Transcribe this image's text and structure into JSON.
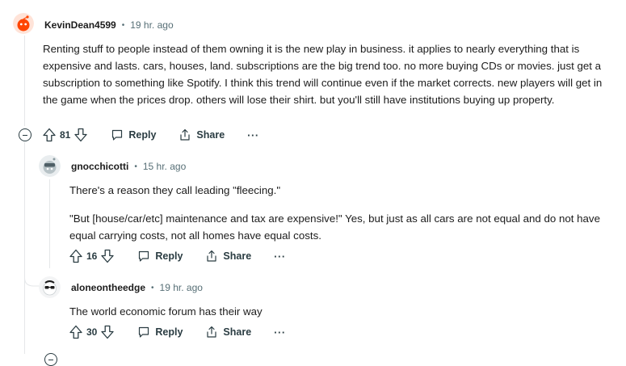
{
  "comments": [
    {
      "username": "KevinDean4599",
      "separator": "•",
      "time": "19 hr. ago",
      "body": "Renting stuff to people instead of them owning it is the new play in business. it applies to nearly everything that is expensive and lasts. cars, houses, land. subscriptions are the big trend too. no more buying CDs or movies. just get a subscription to something like Spotify. I think this trend will continue even if the market corrects. new players will get in the game when the prices drop. others will lose their shirt. but you'll still have institutions buying up property.",
      "votes": "81",
      "reply_label": "Reply",
      "share_label": "Share",
      "more": "···"
    },
    {
      "username": "gnocchicotti",
      "separator": "•",
      "time": "15 hr. ago",
      "body1": "There's a reason they call leading \"fleecing.\"",
      "body2": "\"But [house/car/etc] maintenance and tax are expensive!\" Yes, but just as all cars are not equal and do not have equal carrying costs, not all homes have equal costs.",
      "votes": "16",
      "reply_label": "Reply",
      "share_label": "Share",
      "more": "···"
    },
    {
      "username": "aloneontheedge",
      "separator": "•",
      "time": "19 hr. ago",
      "body": "The world economic forum has their way",
      "votes": "30",
      "reply_label": "Reply",
      "share_label": "Share",
      "more": "···"
    }
  ],
  "colors": {
    "text": "#1c1c1c",
    "meta": "#576f76",
    "action": "#2a3c42",
    "thread_line": "#e5e7e9",
    "avatar_orange": "#ff4500"
  }
}
